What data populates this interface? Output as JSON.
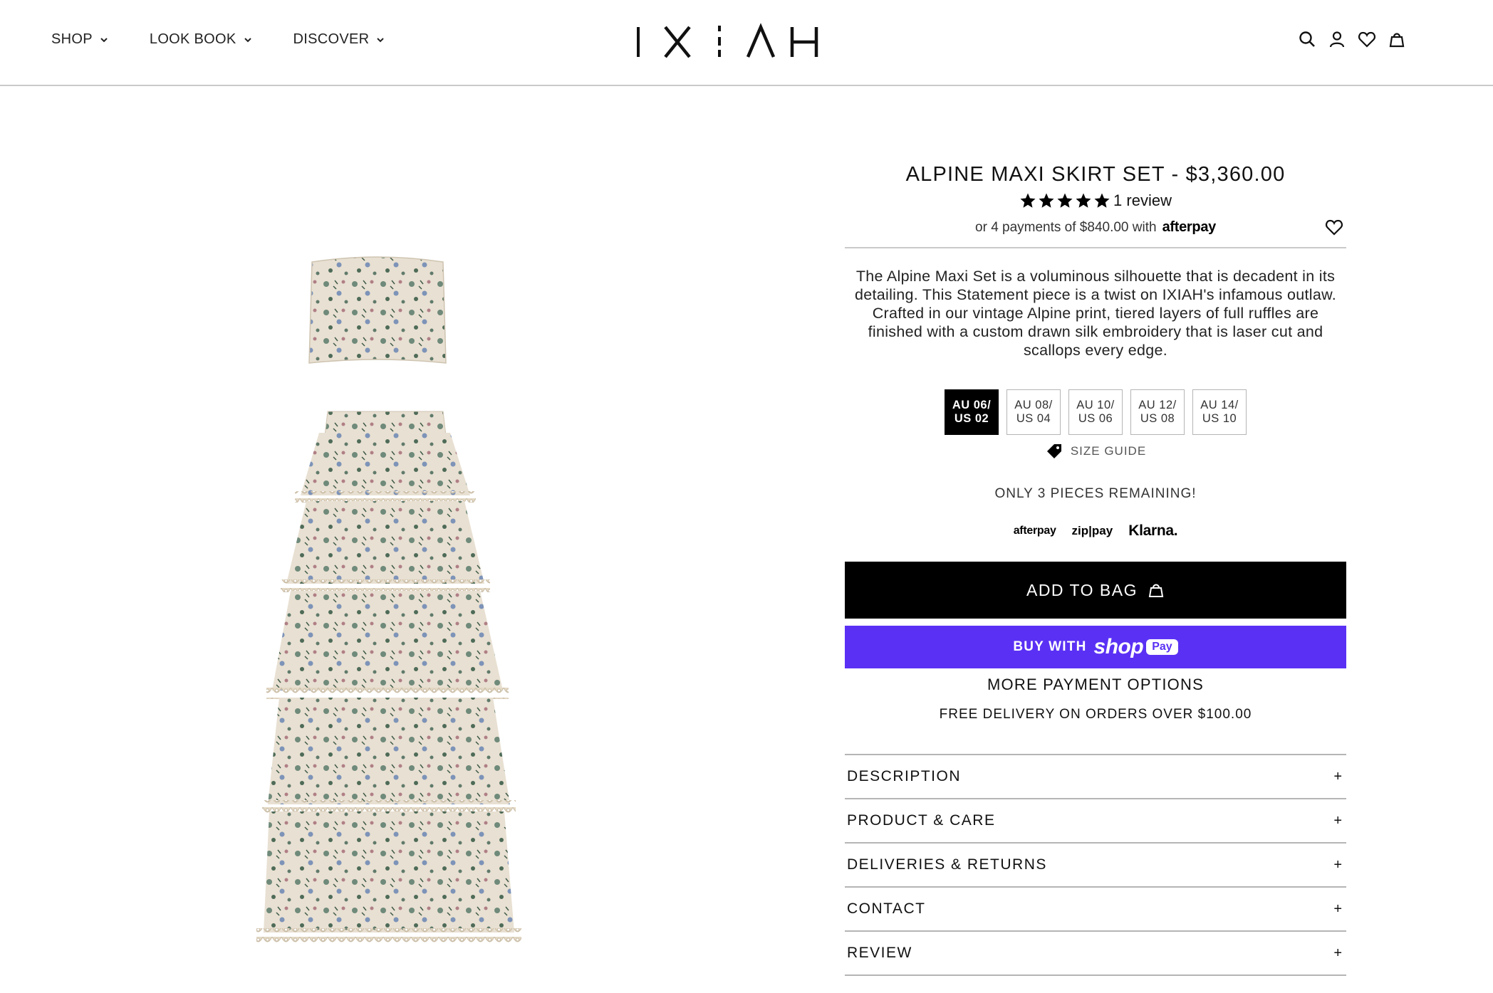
{
  "header": {
    "nav": [
      {
        "label": "SHOP"
      },
      {
        "label": "LOOK BOOK"
      },
      {
        "label": "DISCOVER"
      }
    ],
    "logo_text": "IXIAH"
  },
  "product": {
    "title": "ALPINE MAXI SKIRT SET - $3,360.00",
    "rating_value": 5,
    "review_label": "1 review",
    "afterpay_text": "or 4 payments of $840.00 with",
    "afterpay_brand": "afterpay",
    "description": "The Alpine Maxi Set is a voluminous silhouette that is decadent in its detailing. This Statement piece is a twist on IXIAH's infamous outlaw. Crafted in our vintage Alpine print, tiered layers of full ruffles are finished with a custom drawn silk embroidery that is laser cut and scallops every edge.",
    "sizes": [
      {
        "au": "AU 06/",
        "us": "US 02",
        "selected": true
      },
      {
        "au": "AU 08/",
        "us": "US 04",
        "selected": false
      },
      {
        "au": "AU 10/",
        "us": "US 06",
        "selected": false
      },
      {
        "au": "AU 12/",
        "us": "US 08",
        "selected": false
      },
      {
        "au": "AU 14/",
        "us": "US 10",
        "selected": false
      }
    ],
    "size_guide_label": "SIZE GUIDE",
    "stock_message": "ONLY 3 PIECES REMAINING!",
    "payment_logos": {
      "afterpay": "afterpay",
      "zip": "zip|pay",
      "klarna": "Klarna."
    },
    "add_to_bag_label": "ADD TO BAG",
    "shoppay": {
      "buy_with": "BUY WITH",
      "brand": "shop",
      "pill": "Pay"
    },
    "more_payment_label": "MORE PAYMENT OPTIONS",
    "delivery_note": "FREE DELIVERY ON ORDERS OVER $100.00",
    "accordion": [
      {
        "label": "DESCRIPTION",
        "icon": "+"
      },
      {
        "label": "PRODUCT & CARE",
        "icon": "+"
      },
      {
        "label": "DELIVERIES & RETURNS",
        "icon": "+"
      },
      {
        "label": "CONTACT",
        "icon": "+"
      },
      {
        "label": "REVIEW",
        "icon": "+"
      }
    ]
  },
  "colors": {
    "black": "#000000",
    "shoppay_purple": "#5a31f4",
    "divider": "#c9c9c9"
  }
}
